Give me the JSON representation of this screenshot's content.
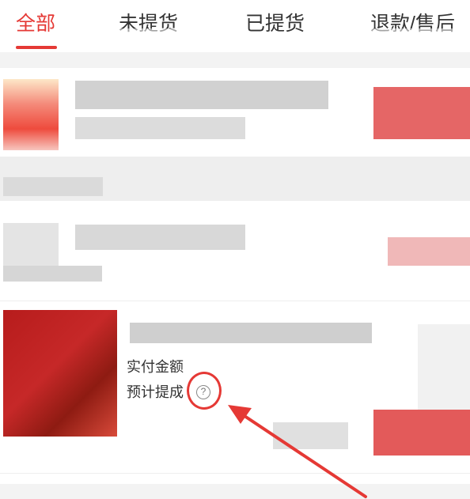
{
  "tabs": [
    {
      "label": "全部",
      "active": true
    },
    {
      "label": "未提货",
      "active": false
    },
    {
      "label": "已提货",
      "active": false
    },
    {
      "label": "退款/售后",
      "active": false
    }
  ],
  "order_card": {
    "paid_amount_label": "实付金额",
    "estimated_commission_label": "预计提成",
    "help_icon_glyph": "?"
  },
  "colors": {
    "accent": "#e53935",
    "annotation": "#e53935"
  }
}
